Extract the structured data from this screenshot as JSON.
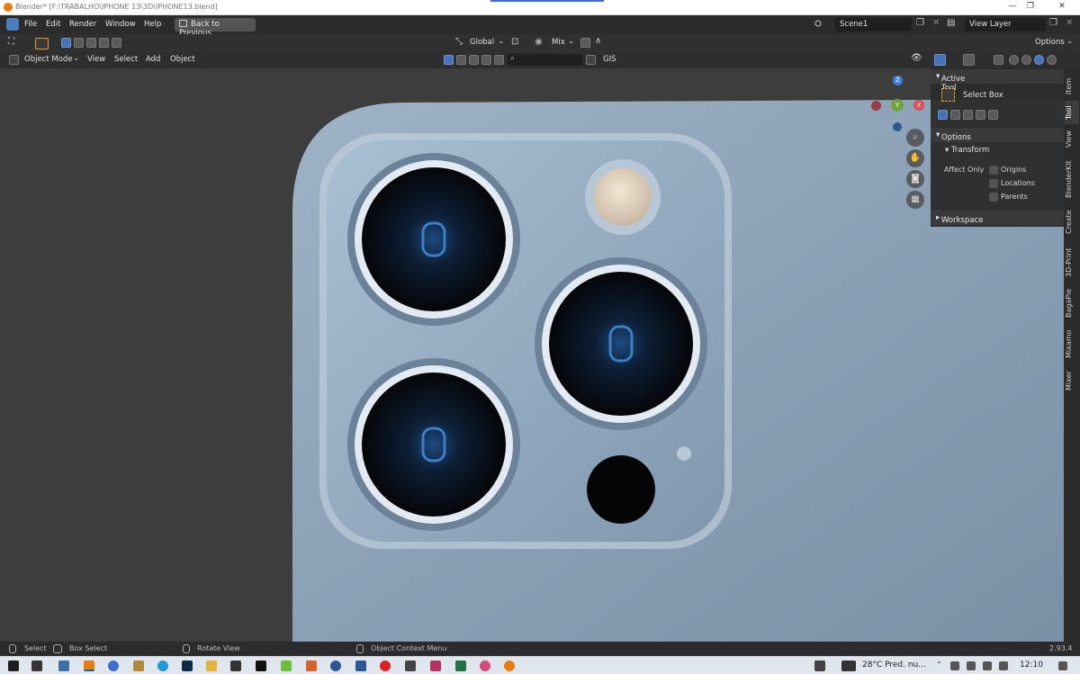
{
  "titlebar": {
    "title": "Blender* [F:\\TRABALHO\\IPHONE 13\\3D\\IPHONE13.blend]",
    "minimize": "—",
    "maximize": "❐",
    "close": "✕"
  },
  "menu": {
    "items": [
      "File",
      "Edit",
      "Render",
      "Window",
      "Help"
    ],
    "back_button": "Back to Previous",
    "scene": "Scene1",
    "view_layer": "View Layer"
  },
  "header1": {
    "transform_orientation": "Global",
    "pivot": "Mix",
    "options": "Options"
  },
  "header2": {
    "mode": "Object Mode",
    "items": [
      "View",
      "Select",
      "Add",
      "Object"
    ],
    "gis": "GIS",
    "search_placeholder": ""
  },
  "gizmo": {
    "x": "X",
    "y": "Y",
    "z": "Z"
  },
  "npanel": {
    "active_tool_header": "Active Tool",
    "select_box": "Select Box",
    "options_header": "Options",
    "transform_header": "Transform",
    "affect_only": "Affect Only",
    "origins": "Origins",
    "locations": "Locations",
    "parents": "Parents",
    "workspace_header": "Workspace"
  },
  "tabs": [
    "Item",
    "Tool",
    "View",
    "BlenderKit",
    "Create",
    "3D-Print",
    "BagaPie",
    "Mixamo",
    "Mixer"
  ],
  "statusbar": {
    "select": "Select",
    "box_select": "Box Select",
    "rotate_view": "Rotate View",
    "object_context_menu": "Object Context Menu",
    "version": "2.93.4"
  },
  "taskbar": {
    "weather": "28°C  Pred. nu...",
    "time": "12:10"
  },
  "colors": {
    "accent": "#4772b3",
    "phone_body": "#8fa6bd",
    "axis_x": "#e04a55",
    "axis_y": "#6da33c",
    "axis_z": "#3d82d6"
  }
}
